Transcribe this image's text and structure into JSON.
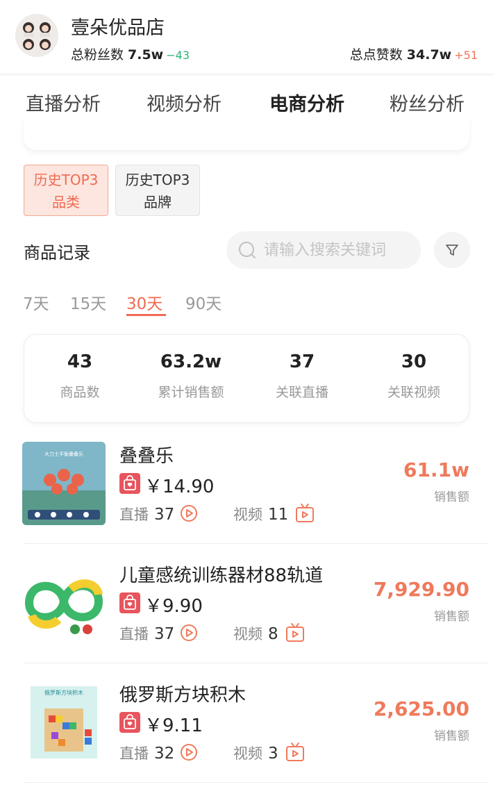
{
  "header": {
    "store_name": "壹朵优品店",
    "fans_label": "总粉丝数",
    "fans_value": "7.5w",
    "fans_delta": "−43",
    "likes_label": "总点赞数",
    "likes_value": "34.7w",
    "likes_delta": "+51"
  },
  "tabs": [
    {
      "label": "直播分析",
      "active": false
    },
    {
      "label": "视频分析",
      "active": false
    },
    {
      "label": "电商分析",
      "active": true
    },
    {
      "label": "粉丝分析",
      "active": false
    }
  ],
  "chips": [
    {
      "line1": "历史TOP3",
      "line2": "品类",
      "active": true
    },
    {
      "line1": "历史TOP3",
      "line2": "品牌",
      "active": false
    }
  ],
  "records": {
    "title": "商品记录",
    "search_placeholder": "请输入搜索关键词",
    "filter_icon": "filter-icon"
  },
  "ranges": [
    "7天",
    "15天",
    "30天",
    "90天"
  ],
  "active_range": "30天",
  "summary": [
    {
      "value": "43",
      "label": "商品数"
    },
    {
      "value": "63.2w",
      "label": "累计销售额"
    },
    {
      "value": "37",
      "label": "关联直播"
    },
    {
      "value": "30",
      "label": "关联视频"
    }
  ],
  "products": [
    {
      "title": "叠叠乐",
      "price": "￥14.90",
      "live_label": "直播",
      "live_count": "37",
      "video_label": "视频",
      "video_count": "11",
      "sales": "61.1w",
      "sales_label": "销售额"
    },
    {
      "title": "儿童感统训练器材88轨道",
      "price": "￥9.90",
      "live_label": "直播",
      "live_count": "37",
      "video_label": "视频",
      "video_count": "8",
      "sales": "7,929.90",
      "sales_label": "销售额"
    },
    {
      "title": "俄罗斯方块积木",
      "price": "￥9.11",
      "live_label": "直播",
      "live_count": "32",
      "video_label": "视频",
      "video_count": "3",
      "sales": "2,625.00",
      "sales_label": "销售额"
    }
  ],
  "thumb_text": {
    "p0": "大力士平衡叠叠乐",
    "p2": "俄罗斯方块积木"
  },
  "colors": {
    "accent": "#ef6b52",
    "up": "#f0745a",
    "down": "#2bb673",
    "shop_icon": "#e8555d"
  }
}
